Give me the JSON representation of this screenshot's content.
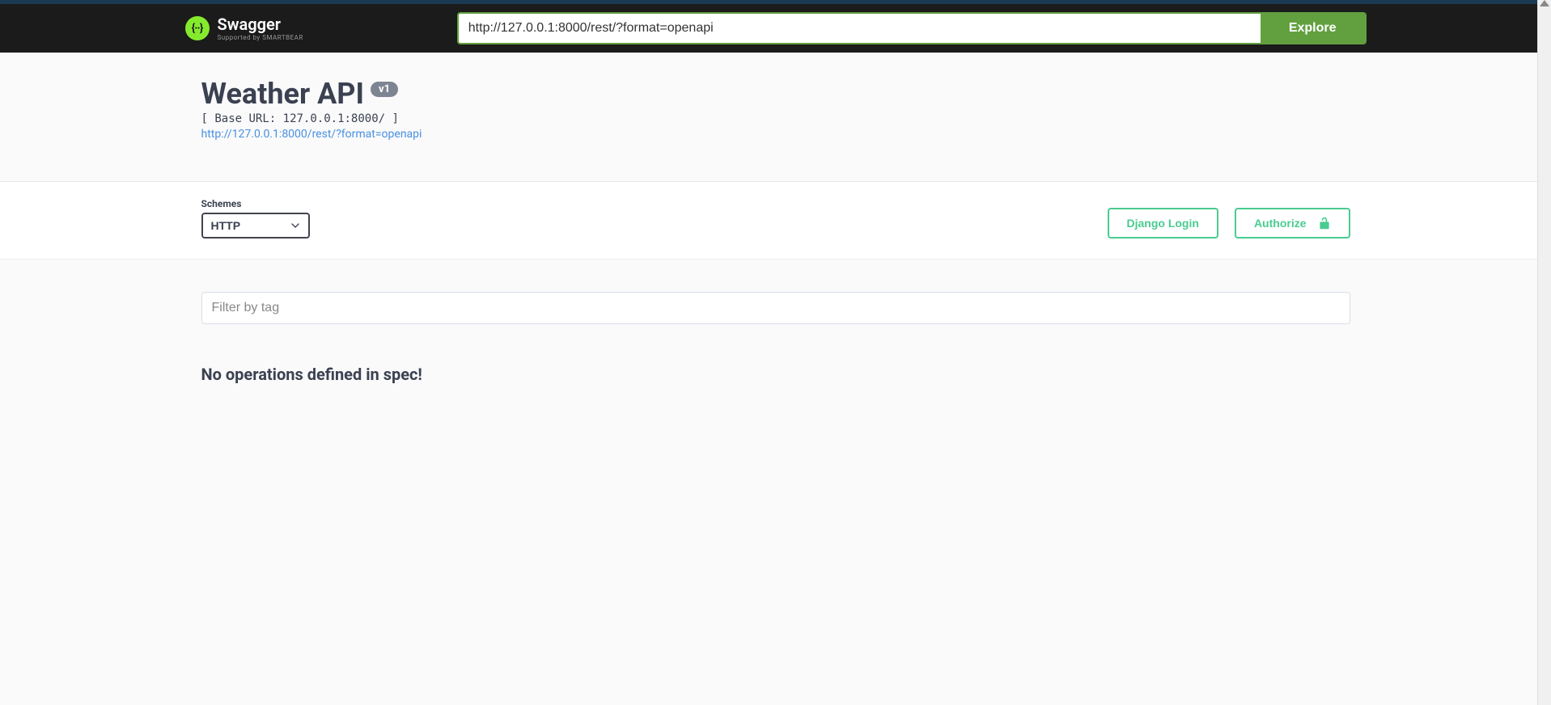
{
  "topbar": {
    "logo_title": "Swagger",
    "logo_subtitle": "Supported by SMARTBEAR",
    "url_value": "http://127.0.0.1:8000/rest/?format=openapi",
    "explore_label": "Explore"
  },
  "info": {
    "title": "Weather API",
    "version": "v1",
    "base_url": "[ Base URL: 127.0.0.1:8000/ ]",
    "spec_link": "http://127.0.0.1:8000/rest/?format=openapi"
  },
  "schemes": {
    "label": "Schemes",
    "selected": "HTTP"
  },
  "auth": {
    "django_login": "Django Login",
    "authorize": "Authorize"
  },
  "filter": {
    "placeholder": "Filter by tag"
  },
  "no_ops": "No operations defined in spec!"
}
